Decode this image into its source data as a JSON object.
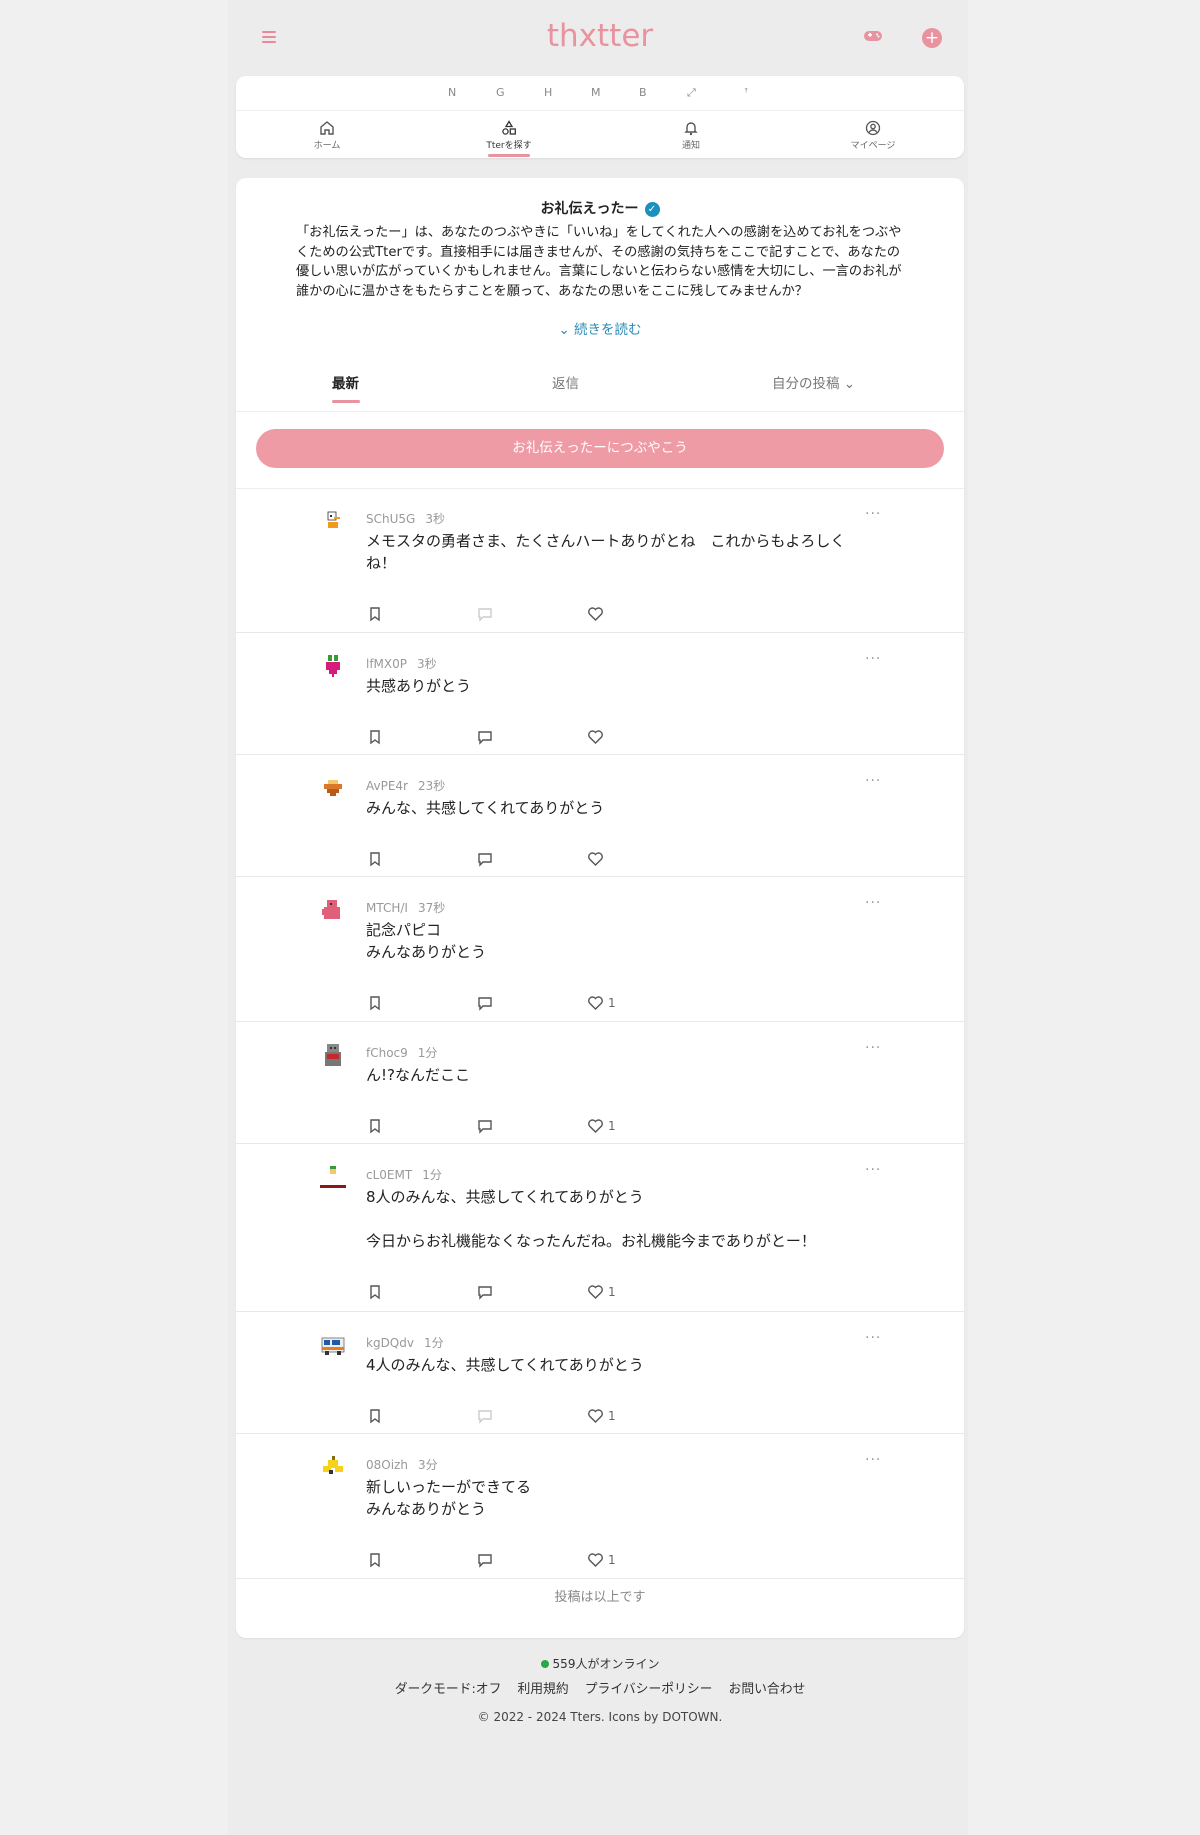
{
  "app": {
    "logo": "thxtter",
    "menu_icon": "hamburger-icon",
    "game_icon": "gamepad-icon",
    "plus_label": "+",
    "accent_color": "#e993a0"
  },
  "letter_nav": [
    "N",
    "G",
    "H",
    "M",
    "B",
    "⤢",
    "ꜛ"
  ],
  "nav_tabs": [
    {
      "label": "ホーム",
      "icon": "home-icon"
    },
    {
      "label": "Tterを探す",
      "icon": "shapes-icon"
    },
    {
      "label": "通知",
      "icon": "bell-icon"
    },
    {
      "label": "マイページ",
      "icon": "user-icon"
    }
  ],
  "channel": {
    "title": "お礼伝えったー",
    "verified_mark": "✓",
    "description": "「お礼伝えったー」は、あなたのつぶやきに「いいね」をしてくれた人への感謝を込めてお礼をつぶやくための公式Tterです。直接相手には届きませんが、その感謝の気持ちをここで記すことで、あなたの優しい思いが広がっていくかもしれません。言葉にしないと伝わらない感情を大切にし、一言のお礼が誰かの心に温かさをもたらすことを願って、あなたの思いをここに残してみませんか？",
    "read_more": "⌄ 続きを読む"
  },
  "tabs": {
    "latest": "最新",
    "replies": "返信",
    "mine": "自分の投稿 ⌄"
  },
  "post_button": "お礼伝えったーにつぶやこう",
  "posts": [
    {
      "user": "SChU5G",
      "time": "3秒",
      "text": "メモスタの勇者さま、たくさんハートありがとね　これからもよろしくね！",
      "likes": "",
      "avatar": "snowman-avatar"
    },
    {
      "user": "lfMX0P",
      "time": "3秒",
      "text": "共感ありがとう",
      "likes": "",
      "avatar": "radish-avatar"
    },
    {
      "user": "AvPE4r",
      "time": "23秒",
      "text": "みんな、共感してくれてありがとう",
      "likes": "",
      "avatar": "pudding-avatar"
    },
    {
      "user": "MTCH/I",
      "time": "37秒",
      "text": "記念パピコ\nみんなありがとう",
      "likes": "1",
      "avatar": "pink-creature-avatar"
    },
    {
      "user": "fChoc9",
      "time": "1分",
      "text": "ん!?なんだここ",
      "likes": "1",
      "avatar": "jizo-avatar"
    },
    {
      "user": "cL0EMT",
      "time": "1分",
      "text": "8人のみんな、共感してくれてありがとう\n\n今日からお礼機能なくなったんだね。お礼機能今までありがとー！",
      "likes": "1",
      "avatar": "shelf-avatar"
    },
    {
      "user": "kgDQdv",
      "time": "1分",
      "text": "4人のみんな、共感してくれてありがとう",
      "likes": "1",
      "avatar": "bus-avatar"
    },
    {
      "user": "08Oizh",
      "time": "3分",
      "text": "新しいったーができてる\nみんなありがとう",
      "likes": "1",
      "avatar": "banana-avatar"
    }
  ],
  "end_message": "投稿は以上です",
  "footer": {
    "online": "559人がオンライン",
    "dark_mode": "ダークモード:オフ",
    "terms": "利用規約",
    "privacy": "プライバシーポリシー",
    "contact": "お問い合わせ",
    "copyright": "© 2022 - 2024 Tters. Icons by DOTOWN."
  }
}
